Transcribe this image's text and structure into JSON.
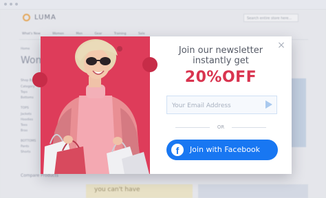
{
  "background_page": {
    "logo_text": "LUMA",
    "search_placeholder": "Search entire store here...",
    "nav_items": [
      "What's New",
      "Women",
      "Men",
      "Gear",
      "Training",
      "Sale"
    ],
    "breadcrumb": "Home",
    "page_title": "Women",
    "sidebar": [
      "Shop By",
      "Category",
      "Tops",
      "Bottoms",
      "TOPS",
      "Jackets",
      "Hoodies",
      "Tees",
      "Bras",
      "BOTTOMS",
      "Pants",
      "Shorts"
    ],
    "compare_heading": "Compare Products",
    "promo_text": "you can't have"
  },
  "popup": {
    "title_line1": "Join our newsletter",
    "title_line2": "instantly get",
    "discount": "20%OFF",
    "email_placeholder": "Your Email Address",
    "or_text": "OR",
    "facebook_button": "Join with Facebook",
    "close_glyph": "×",
    "facebook_glyph": "f"
  },
  "colors": {
    "accent_red": "#d9344f",
    "photo_bg": "#de3c5a",
    "facebook_blue": "#1877f2"
  }
}
